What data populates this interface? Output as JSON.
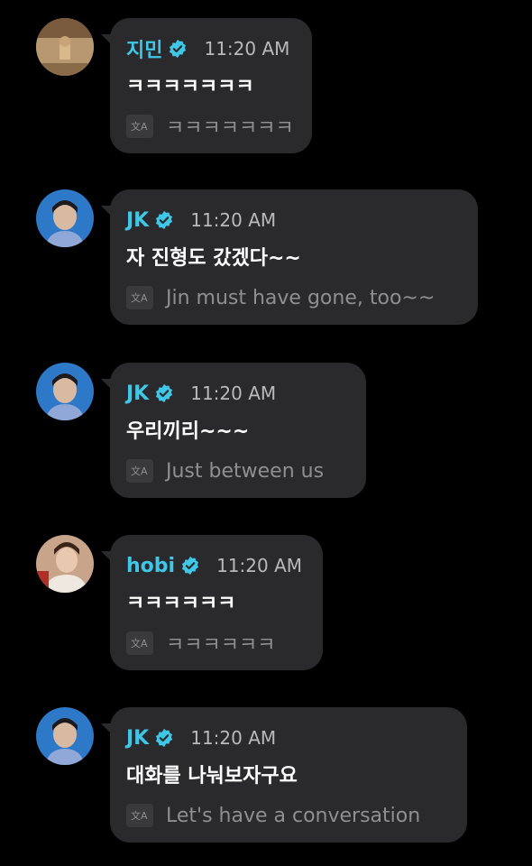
{
  "messages": [
    {
      "name": "지민",
      "time": "11:20 AM",
      "text": "ㅋㅋㅋㅋㅋㅋㅋ",
      "translation": "ㅋㅋㅋㅋㅋㅋㅋ",
      "avatar": "jimin-avatar"
    },
    {
      "name": "JK",
      "time": "11:20 AM",
      "text": "자 진형도 갔겠다~~",
      "translation": "Jin must have gone, too~~",
      "avatar": "jk-avatar"
    },
    {
      "name": "JK",
      "time": "11:20 AM",
      "text": "우리끼리~~~",
      "translation": "Just between us",
      "avatar": "jk-avatar"
    },
    {
      "name": "hobi",
      "time": "11:20 AM",
      "text": "ㅋㅋㅋㅋㅋㅋ",
      "translation": "ㅋㅋㅋㅋㅋㅋ",
      "avatar": "hobi-avatar"
    },
    {
      "name": "JK",
      "time": "11:20 AM",
      "text": "대화를 나눠보자구요",
      "translation": "Let's have a conversation",
      "avatar": "jk-avatar"
    }
  ],
  "colors": {
    "background": "#000000",
    "bubble": "#2a2a2c",
    "name": "#3fc7e8",
    "verified": "#3fc7e8"
  },
  "icons": {
    "verified": "verified-badge-icon",
    "translate": "translate-icon"
  }
}
